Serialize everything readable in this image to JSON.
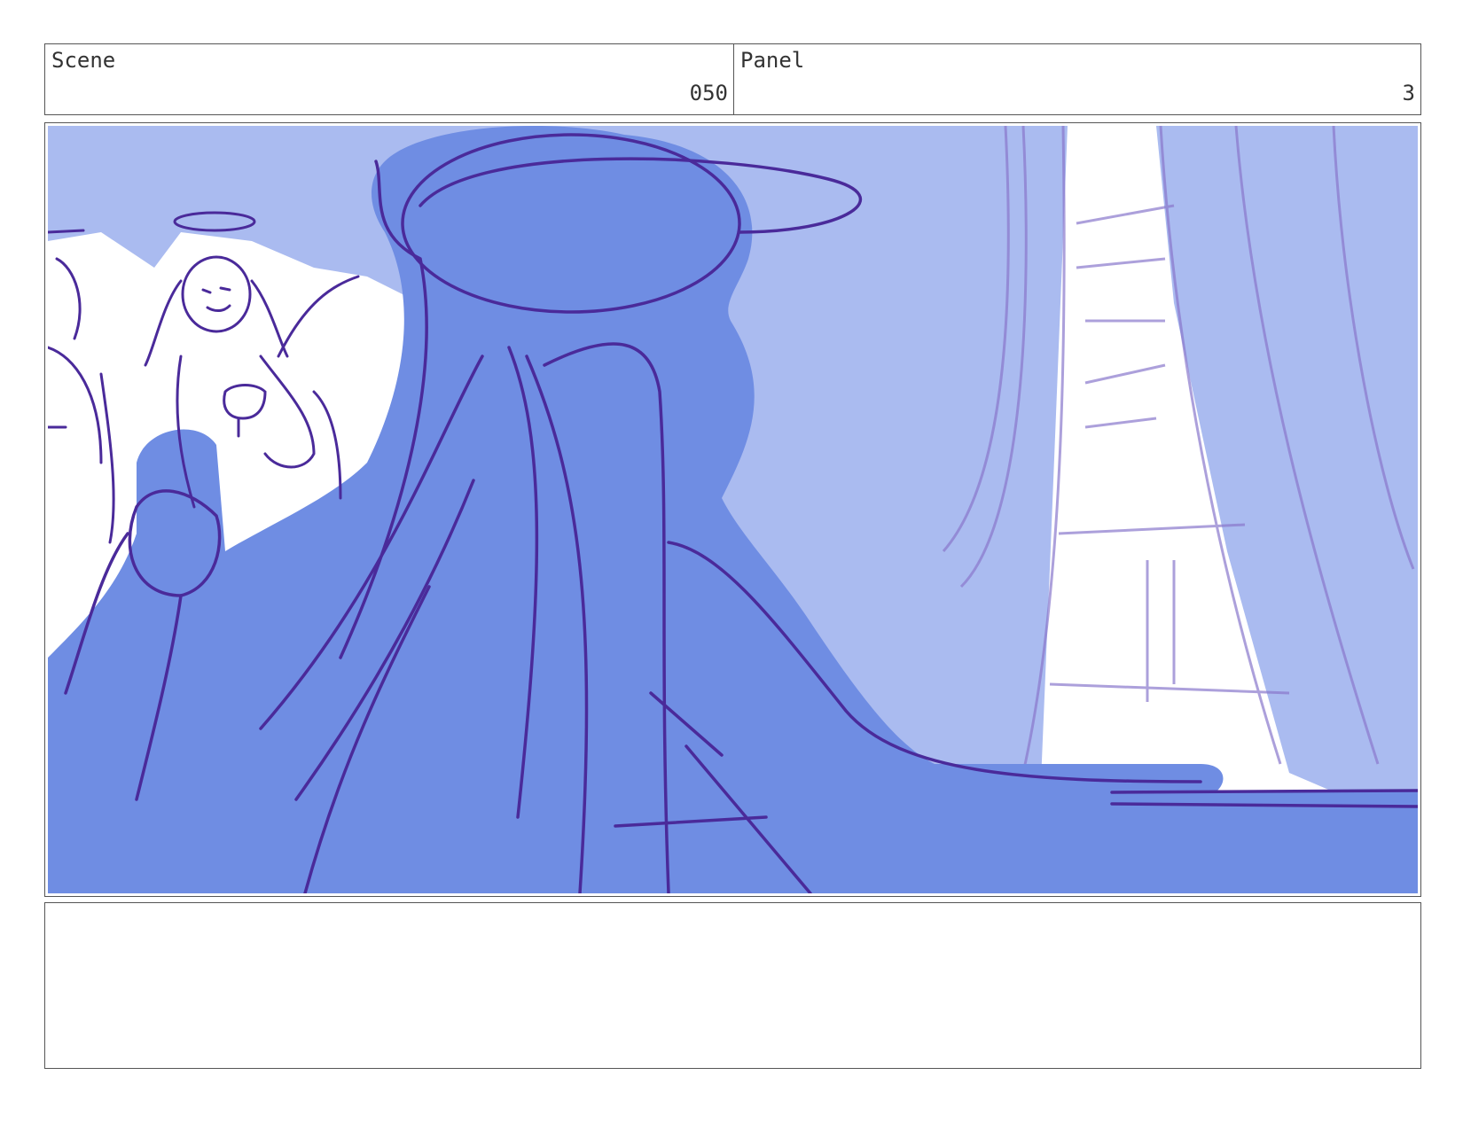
{
  "header": {
    "scene_label": "Scene",
    "scene_value": "050",
    "panel_label": "Panel",
    "panel_value": "3"
  },
  "notes": {
    "text": ""
  },
  "colors": {
    "background_wash": "#aabbf0",
    "figure_fill": "#6f8de3",
    "line": "#4a2a9a",
    "window_light": "#ffffff"
  }
}
